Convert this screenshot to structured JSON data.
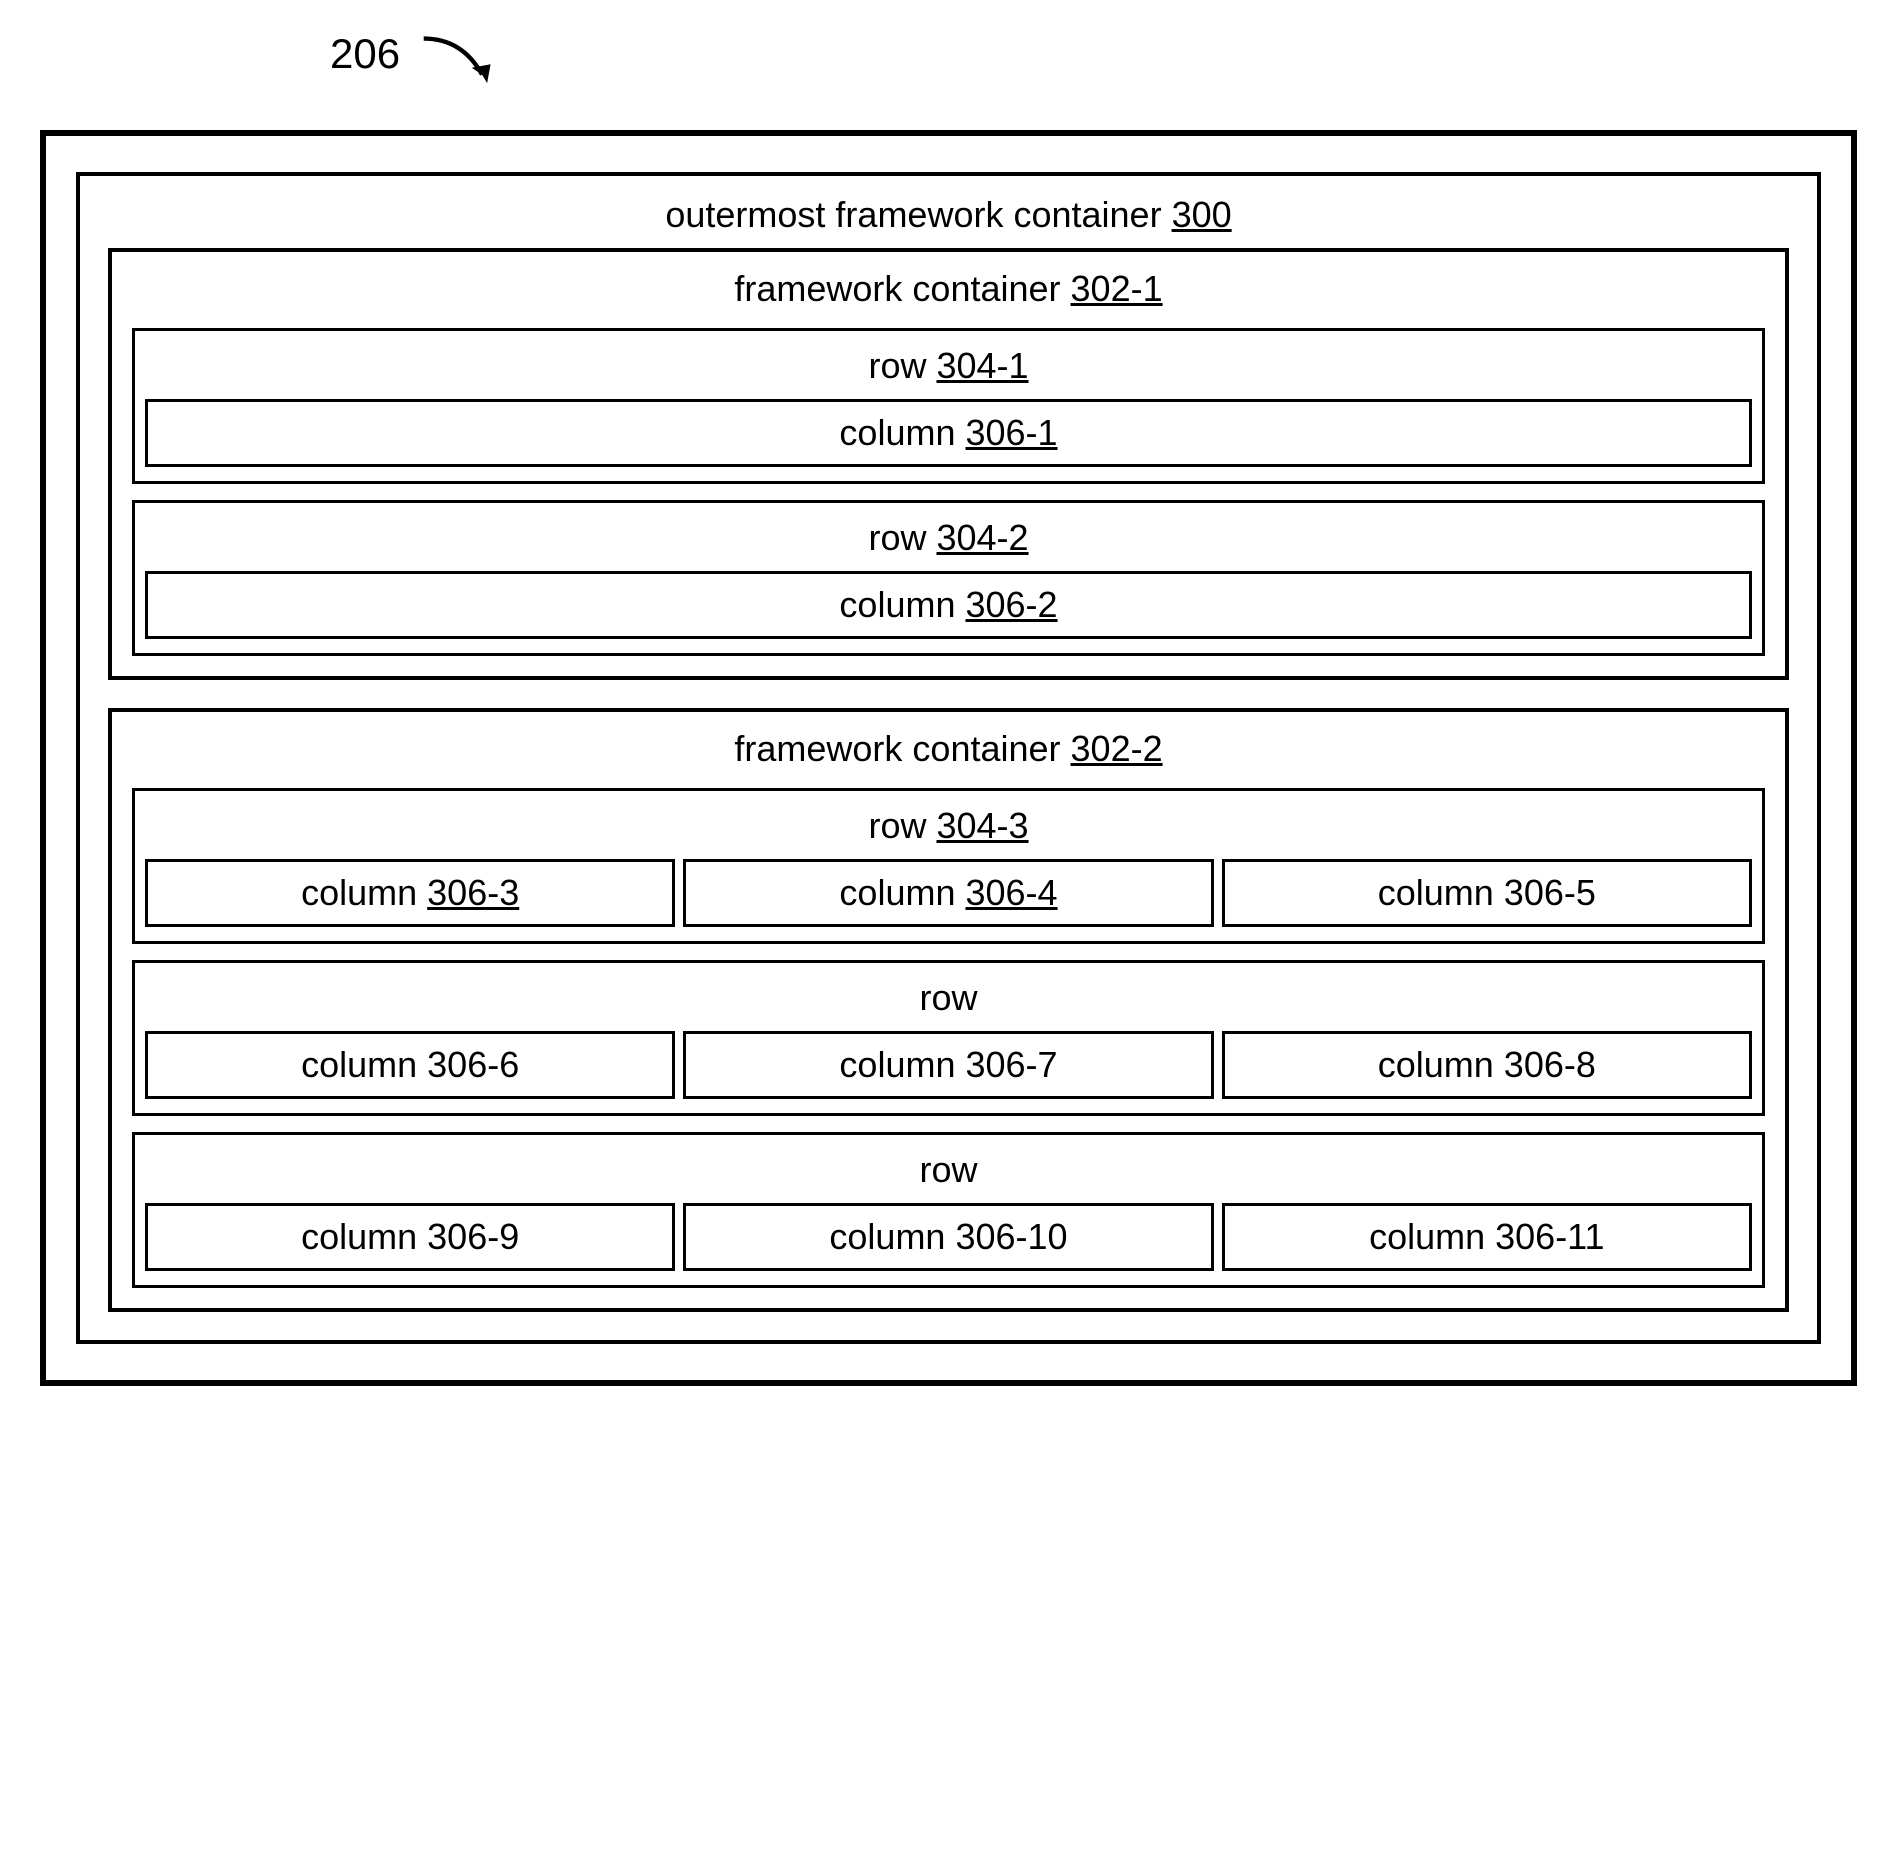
{
  "callout": "206",
  "outermost": {
    "text": "outermost framework container ",
    "ref": "300"
  },
  "containers": [
    {
      "label": {
        "text": "framework container ",
        "ref": "302-1"
      },
      "rows": [
        {
          "label": {
            "text": "row ",
            "ref": "304-1"
          },
          "columns": [
            {
              "text": "column ",
              "ref": "306-1"
            }
          ]
        },
        {
          "label": {
            "text": "row ",
            "ref": "304-2"
          },
          "columns": [
            {
              "text": "column ",
              "ref": "306-2"
            }
          ]
        }
      ]
    },
    {
      "label": {
        "text": "framework container ",
        "ref": "302-2"
      },
      "rows": [
        {
          "label": {
            "text": "row ",
            "ref": "304-3"
          },
          "columns": [
            {
              "text": "column ",
              "ref": "306-3"
            },
            {
              "text": "column ",
              "ref": "306-4"
            },
            {
              "text": "column 306-5",
              "ref": ""
            }
          ]
        },
        {
          "label": {
            "text": "row",
            "ref": ""
          },
          "columns": [
            {
              "text": "column 306-6",
              "ref": ""
            },
            {
              "text": "column 306-7",
              "ref": ""
            },
            {
              "text": "column 306-8",
              "ref": ""
            }
          ]
        },
        {
          "label": {
            "text": "row",
            "ref": ""
          },
          "columns": [
            {
              "text": "column 306-9",
              "ref": ""
            },
            {
              "text": "column 306-10",
              "ref": ""
            },
            {
              "text": "column 306-11",
              "ref": ""
            }
          ]
        }
      ]
    }
  ]
}
